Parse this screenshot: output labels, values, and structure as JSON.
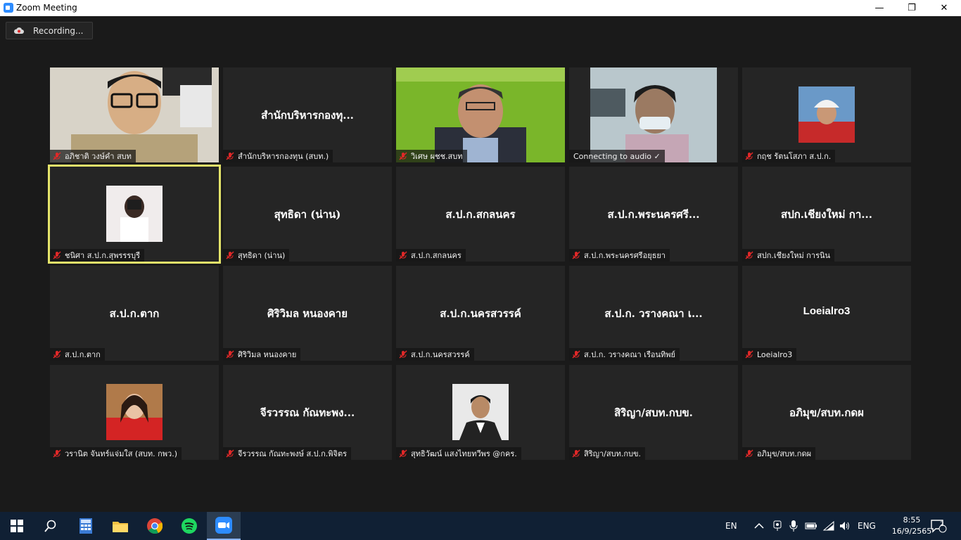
{
  "window": {
    "title": "Zoom Meeting",
    "minimize": "—",
    "restore": "❐",
    "close": "✕"
  },
  "recording": {
    "label": "Recording..."
  },
  "participants": [
    {
      "name": "อภิชาติ  วงษ์คำ สบท",
      "display": "",
      "video": "man-office"
    },
    {
      "name": "สำนักบริหารกองทุน (สบท.)",
      "display": "สำนักบริหารกองทุ...",
      "video": ""
    },
    {
      "name": "วิเศษ ผชช.สบท",
      "display": "",
      "video": "man-green"
    },
    {
      "name": "",
      "display": "",
      "video": "woman-mask",
      "status": "Connecting to audio ✓"
    },
    {
      "name": "กฤช รัตนโสภา ส.ป.ก.",
      "display": "",
      "video": "photo-helmet"
    },
    {
      "name": "ชนิศา ส.ป.ก.สุพรรรบุรี",
      "display": "",
      "video": "photo-camera",
      "active": true
    },
    {
      "name": "สุทธิดา (น่าน)",
      "display": "สุทธิดา (น่าน)",
      "video": ""
    },
    {
      "name": "ส.ป.ก.สกลนคร",
      "display": "ส.ป.ก.สกลนคร",
      "video": ""
    },
    {
      "name": "ส.ป.ก.พระนครศรีอยุธยา",
      "display": "ส.ป.ก.พระนครศรี...",
      "video": ""
    },
    {
      "name": "สปก.เชียงใหม่ การนิน",
      "display": "สปก.เชียงใหม่ กา...",
      "video": ""
    },
    {
      "name": "ส.ป.ก.ตาก",
      "display": "ส.ป.ก.ตาก",
      "video": ""
    },
    {
      "name": "ศิริวิมล หนองคาย",
      "display": "ศิริวิมล หนองคาย",
      "video": ""
    },
    {
      "name": "ส.ป.ก.นครสวรรค์",
      "display": "ส.ป.ก.นครสวรรค์",
      "video": ""
    },
    {
      "name": "ส.ป.ก. วรางคณา เรือนทิพย์",
      "display": "ส.ป.ก. วรางคณา เ...",
      "video": ""
    },
    {
      "name": "Loeialro3",
      "display": "Loeialro3",
      "video": ""
    },
    {
      "name": "วรานิต จันทร์แจ่มใส (สบท. กพว.)",
      "display": "",
      "video": "photo-red"
    },
    {
      "name": "จีรวรรณ กัณทะพงษ์ ส.ป.ก.พิจิตร",
      "display": "จีรวรรณ กัณทะพง...",
      "video": ""
    },
    {
      "name": "สุทธิวัฒน์ แสงไทยทวีพร @กคร.",
      "display": "",
      "video": "photo-suit"
    },
    {
      "name": "สิริญา/สบท.กบข.",
      "display": "สิริญา/สบท.กบข.",
      "video": ""
    },
    {
      "name": "อภิมุข/สบท.กดผ",
      "display": "อภิมุข/สบท.กดผ",
      "video": ""
    }
  ],
  "taskbar": {
    "lang_indicator": "EN",
    "keyboard": "ENG",
    "time": "8:55",
    "date": "16/9/2565",
    "notifications": "2"
  }
}
